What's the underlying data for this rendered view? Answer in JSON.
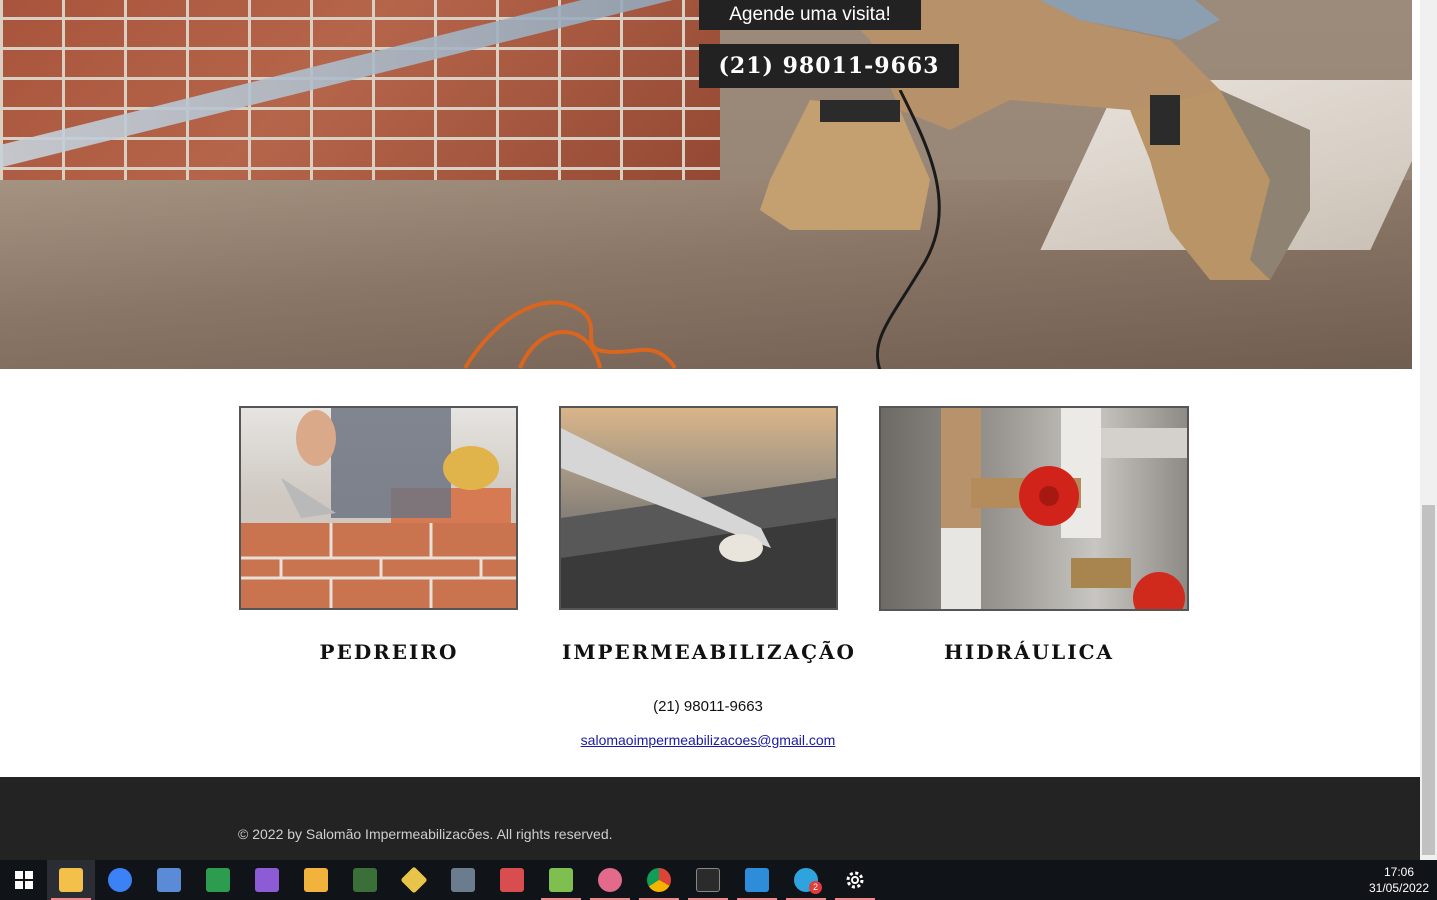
{
  "hero": {
    "cta_visit": "Agende uma visita!",
    "cta_phone": "(21) 98011-9663"
  },
  "services": [
    {
      "title": "PEDREIRO",
      "image": "bricklaying-photo"
    },
    {
      "title": "IMPERMEABILIZAÇÃO",
      "image": "waterproofing-photo"
    },
    {
      "title": "HIDRÁULICA",
      "image": "plumbing-valve-photo"
    }
  ],
  "contact": {
    "phone": "(21) 98011-9663",
    "email": "salomaoimpermeabilizacoes@gmail.com"
  },
  "footer": {
    "copyright": "© 2022 by Salomão Impermeabilizacões. All rights reserved."
  },
  "taskbar": {
    "apps": [
      {
        "name": "windows-start",
        "color": "#ffffff"
      },
      {
        "name": "file-explorer",
        "color": "#f3c04a",
        "active": true
      },
      {
        "name": "firefox",
        "color": "#3b82f6"
      },
      {
        "name": "remote-desktop",
        "color": "#5b8bd6"
      },
      {
        "name": "csharp-app",
        "color": "#2e9c4e"
      },
      {
        "name": "visual-studio",
        "color": "#8e5bd6"
      },
      {
        "name": "outlook-app",
        "color": "#f2b33d"
      },
      {
        "name": "teams-app",
        "color": "#3a6f3a"
      },
      {
        "name": "git-app",
        "color": "#e9c44a"
      },
      {
        "name": "image-viewer",
        "color": "#6a7c8e"
      },
      {
        "name": "snipping-tool",
        "color": "#d84d4d"
      },
      {
        "name": "notepad-plus",
        "color": "#7fbf4f",
        "running": true
      },
      {
        "name": "paint-app",
        "color": "#e36a8a",
        "running": true
      },
      {
        "name": "chrome",
        "color": "#e8b13a",
        "running": true
      },
      {
        "name": "terminal",
        "color": "#2b2b2b",
        "running": true
      },
      {
        "name": "vscode",
        "color": "#2e8ddb",
        "running": true
      },
      {
        "name": "telegram",
        "color": "#2ea3dd",
        "running": true,
        "badge": "2"
      },
      {
        "name": "settings",
        "color": "#ffffff",
        "running": true
      }
    ],
    "time": "17:06",
    "date": "31/05/2022"
  }
}
